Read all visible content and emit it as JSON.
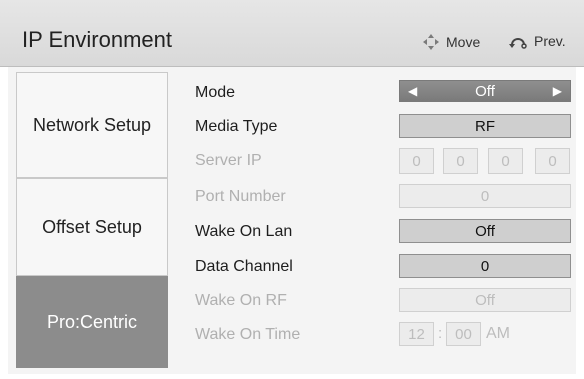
{
  "header": {
    "title": "IP Environment",
    "move_label": "Move",
    "prev_label": "Prev.",
    "move_icon": "four-way-arrows-icon",
    "prev_icon": "return-icon"
  },
  "sidebar": {
    "items": [
      {
        "label": "Network Setup",
        "active": false
      },
      {
        "label": "Offset Setup",
        "active": false
      },
      {
        "label": "Pro:Centric",
        "active": true
      }
    ]
  },
  "settings": {
    "mode": {
      "label": "Mode",
      "value": "Off"
    },
    "media_type": {
      "label": "Media Type",
      "value": "RF"
    },
    "server_ip": {
      "label": "Server IP",
      "octets": [
        "0",
        "0",
        "0",
        "0"
      ],
      "enabled": false
    },
    "port_number": {
      "label": "Port Number",
      "value": "0",
      "enabled": false
    },
    "wake_on_lan": {
      "label": "Wake On Lan",
      "value": "Off"
    },
    "data_channel": {
      "label": "Data Channel",
      "value": "0"
    },
    "wake_on_rf": {
      "label": "Wake On RF",
      "value": "Off",
      "enabled": false
    },
    "wake_on_time": {
      "label": "Wake On Time",
      "hour": "12",
      "minute": "00",
      "ampm": "AM",
      "enabled": false
    }
  },
  "colors": {
    "header_bg": "#dddddd",
    "selected_bg": "#8c8c8c",
    "field_bg": "#cfcfcf",
    "disabled_text": "#b0b0b0"
  }
}
